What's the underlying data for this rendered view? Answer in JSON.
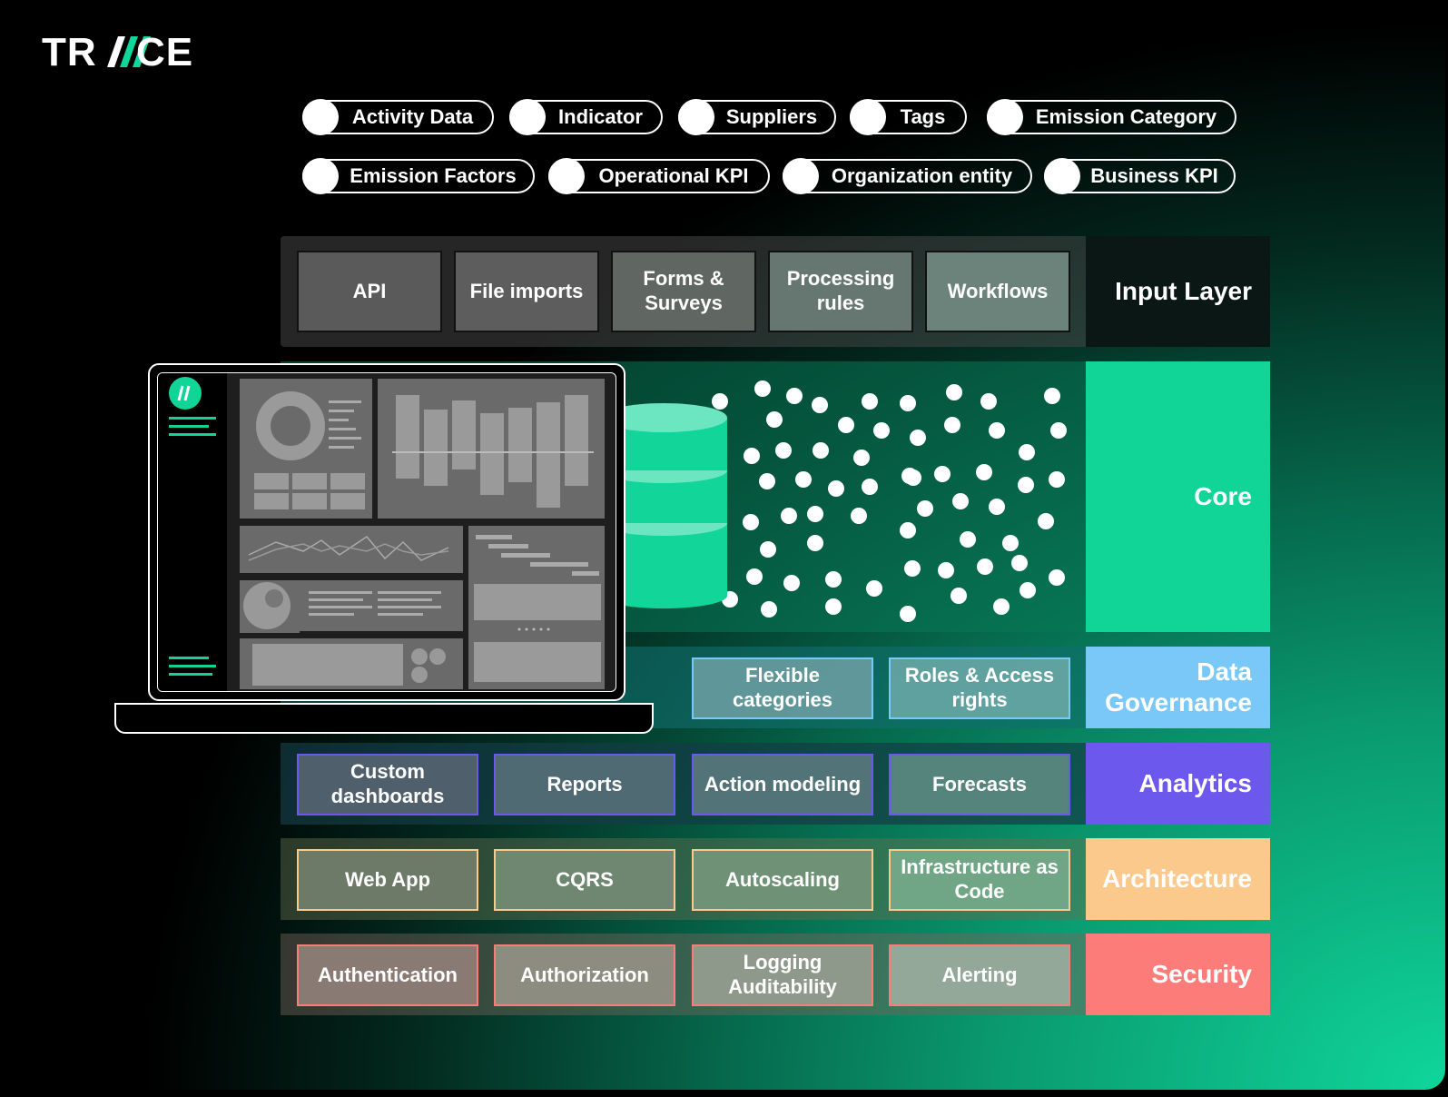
{
  "logo": {
    "text": "TRACE",
    "accent": "#0fd69a"
  },
  "tags": {
    "row1": [
      "Activity Data",
      "Indicator",
      "Suppliers",
      "Tags",
      "Emission Category"
    ],
    "row2": [
      "Emission Factors",
      "Operational KPI",
      "Organization entity",
      "Business KPI"
    ]
  },
  "layers": {
    "input": {
      "label": "Input Layer",
      "color": "#0b1714",
      "boxes": [
        "API",
        "File imports",
        "Forms & Surveys",
        "Processing rules",
        "Workflows"
      ]
    },
    "core": {
      "label": "Core",
      "color": "#10d596"
    },
    "data_governance": {
      "label": "Data Governance",
      "color": "#7ac8f7",
      "boxes": [
        "Flexible categories",
        "Roles & Access rights"
      ]
    },
    "analytics": {
      "label": "Analytics",
      "color": "#6d58ee",
      "boxes": [
        "Custom dashboards",
        "Reports",
        "Action modeling",
        "Forecasts"
      ]
    },
    "architecture": {
      "label": "Architecture",
      "color": "#fbc98c",
      "boxes": [
        "Web App",
        "CQRS",
        "Autoscaling",
        "Infrastructure as Code"
      ]
    },
    "security": {
      "label": "Security",
      "color": "#fb7c78",
      "boxes": [
        "Authentication",
        "Authorization",
        "Logging Auditability",
        "Alerting"
      ]
    }
  },
  "icons": {
    "database": "database-icon",
    "laptop": "laptop-dashboard-illustration",
    "app_logo": "trace-app-logo-icon"
  }
}
